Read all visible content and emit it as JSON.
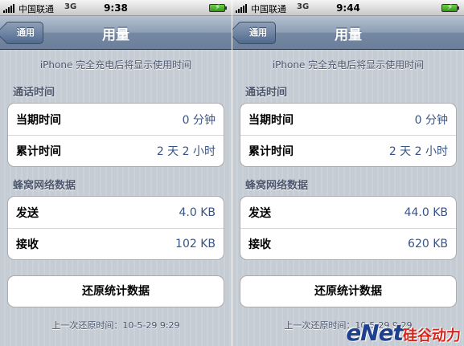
{
  "left": {
    "status": {
      "carrier": "中国联通",
      "network": "3G",
      "time": "9:38"
    },
    "nav": {
      "back": "通用",
      "title": "用量"
    },
    "note": "iPhone 完全充电后将显示使用时间",
    "call_section": {
      "header": "通话时间",
      "rows": [
        {
          "label": "当期时间",
          "value": "0 分钟"
        },
        {
          "label": "累计时间",
          "value": "2 天 2 小时"
        }
      ]
    },
    "data_section": {
      "header": "蜂窝网络数据",
      "rows": [
        {
          "label": "发送",
          "value": "4.0 KB"
        },
        {
          "label": "接收",
          "value": "102 KB"
        }
      ]
    },
    "reset_button": "还原统计数据",
    "last_reset": "上一次还原时间：10-5-29 9:29"
  },
  "right": {
    "status": {
      "carrier": "中国联通",
      "network": "3G",
      "time": "9:44"
    },
    "nav": {
      "back": "通用",
      "title": "用量"
    },
    "note": "iPhone 完全充电后将显示使用时间",
    "call_section": {
      "header": "通话时间",
      "rows": [
        {
          "label": "当期时间",
          "value": "0 分钟"
        },
        {
          "label": "累计时间",
          "value": "2 天 2 小时"
        }
      ]
    },
    "data_section": {
      "header": "蜂窝网络数据",
      "rows": [
        {
          "label": "发送",
          "value": "44.0 KB"
        },
        {
          "label": "接收",
          "value": "620 KB"
        }
      ]
    },
    "reset_button": "还原统计数据",
    "last_reset": "上一次还原时间：10-5-29 9:29"
  },
  "watermark": {
    "latin": "eNet",
    "cn": "硅谷动力"
  },
  "colors": {
    "value_blue": "#385487",
    "nav_blue": "#6b7f9b",
    "background": "#c5ccd4"
  }
}
